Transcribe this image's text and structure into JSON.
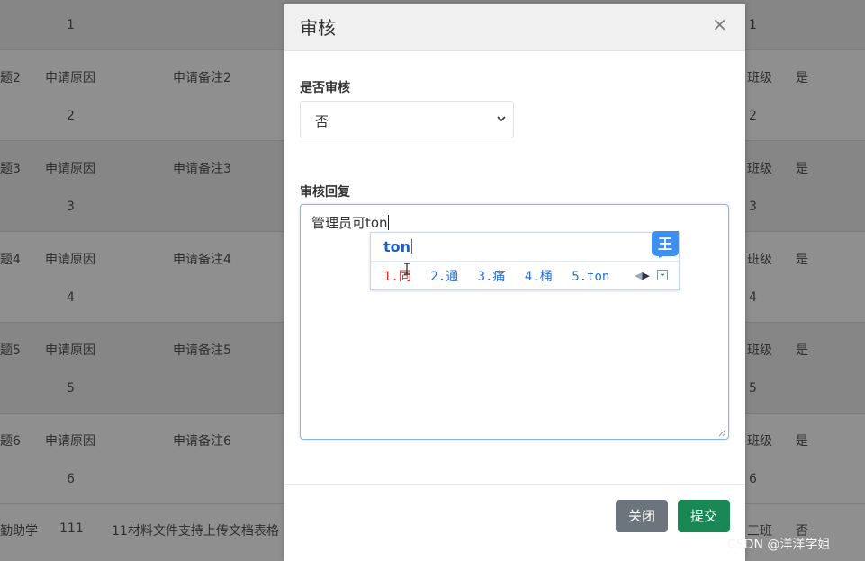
{
  "background_table": {
    "first_row_seq": "1",
    "first_row_right": "1",
    "rows": [
      {
        "topic": "题2",
        "reason": "申请原因",
        "remark": "申请备注2",
        "seq": "2",
        "class": "班级",
        "flag": "是",
        "num": "2"
      },
      {
        "topic": "题3",
        "reason": "申请原因",
        "remark": "申请备注3",
        "seq": "3",
        "class": "班级",
        "flag": "是",
        "num": "3"
      },
      {
        "topic": "题4",
        "reason": "申请原因",
        "remark": "申请备注4",
        "seq": "4",
        "class": "班级",
        "flag": "是",
        "num": "4"
      },
      {
        "topic": "题5",
        "reason": "申请原因",
        "remark": "申请备注5",
        "seq": "5",
        "class": "班级",
        "flag": "是",
        "num": "5"
      },
      {
        "topic": "题6",
        "reason": "申请原因",
        "remark": "申请备注6",
        "seq": "6",
        "class": "班级",
        "flag": "是",
        "num": "6"
      }
    ],
    "last_row": {
      "topic": "勤助学",
      "reason": "111",
      "remark": "11材料文件支持上传文档表格",
      "class": "三班",
      "flag": "否"
    }
  },
  "modal": {
    "title": "审核",
    "close_symbol": "×",
    "audit_label": "是否审核",
    "audit_selected": "否",
    "reply_label": "审核回复",
    "reply_text": "管理员可ton",
    "close_button": "关闭",
    "submit_button": "提交"
  },
  "ime": {
    "composition": "ton",
    "logo_glyph": "王",
    "candidates": [
      "1.同",
      "2.通",
      "3.痛",
      "4.桶",
      "5.ton"
    ]
  },
  "watermark": "CSDN @洋洋学姐",
  "colors": {
    "submit": "#198754",
    "close": "#6c757d",
    "ime_blue": "#2a6fd0",
    "ime_highlight": "#e03030"
  }
}
